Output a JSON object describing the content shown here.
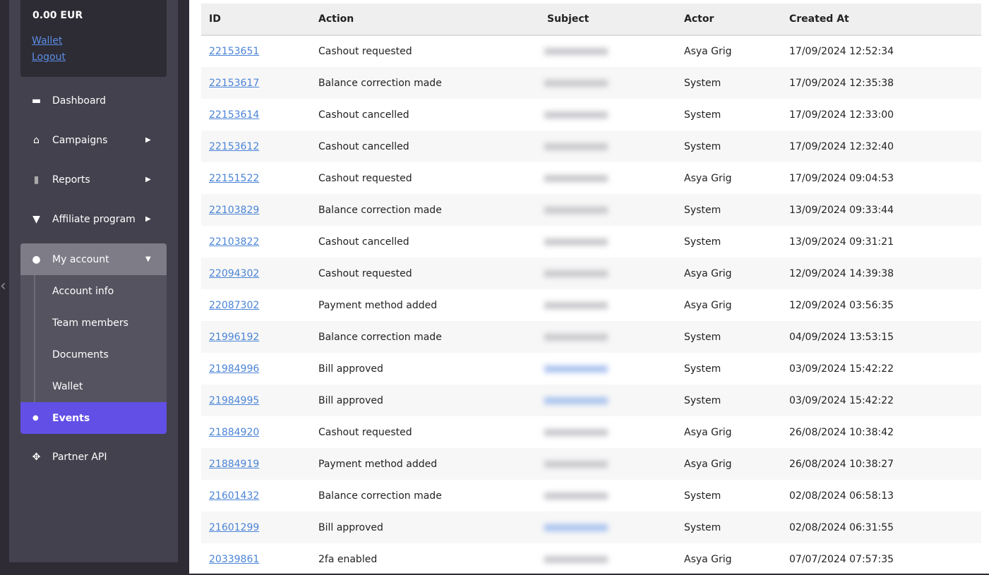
{
  "account": {
    "balance": "0.00  EUR",
    "wallet_link": "Wallet",
    "logout_link": "Logout"
  },
  "nav": {
    "dashboard": "Dashboard",
    "campaigns": "Campaigns",
    "reports": "Reports",
    "affiliate": "Affiliate program",
    "my_account": "My account",
    "account_info": "Account info",
    "team_members": "Team members",
    "documents": "Documents",
    "wallet": "Wallet",
    "events": "Events",
    "partner_api": "Partner API"
  },
  "colors": {
    "accent": "#624fe6",
    "link": "#4a84d6"
  },
  "table": {
    "headers": [
      "ID",
      "Action",
      "Subject",
      "Actor",
      "Created At"
    ],
    "rows": [
      [
        "22153651",
        "Cashout requested",
        "Asya Grig",
        "17/09/2024 12:52:34"
      ],
      [
        "22153617",
        "Balance correction made",
        "System",
        "17/09/2024 12:35:38"
      ],
      [
        "22153614",
        "Cashout cancelled",
        "System",
        "17/09/2024 12:33:00"
      ],
      [
        "22153612",
        "Cashout cancelled",
        "System",
        "17/09/2024 12:32:40"
      ],
      [
        "22151522",
        "Cashout requested",
        "Asya Grig",
        "17/09/2024 09:04:53"
      ],
      [
        "22103829",
        "Balance correction made",
        "System",
        "13/09/2024 09:33:44"
      ],
      [
        "22103822",
        "Cashout cancelled",
        "System",
        "13/09/2024 09:31:21"
      ],
      [
        "22094302",
        "Cashout requested",
        "Asya Grig",
        "12/09/2024 14:39:38"
      ],
      [
        "22087302",
        "Payment method added",
        "Asya Grig",
        "12/09/2024 03:56:35"
      ],
      [
        "21996192",
        "Balance correction made",
        "System",
        "04/09/2024 13:53:15"
      ],
      [
        "21984996",
        "Bill approved",
        "System",
        "03/09/2024 15:42:22"
      ],
      [
        "21984995",
        "Bill approved",
        "System",
        "03/09/2024 15:42:22"
      ],
      [
        "21884920",
        "Cashout requested",
        "Asya Grig",
        "26/08/2024 10:38:42"
      ],
      [
        "21884919",
        "Payment method added",
        "Asya Grig",
        "26/08/2024 10:38:27"
      ],
      [
        "21601432",
        "Balance correction made",
        "System",
        "02/08/2024 06:58:13"
      ],
      [
        "21601299",
        "Bill approved",
        "System",
        "02/08/2024 06:31:55"
      ],
      [
        "20339861",
        "2fa enabled",
        "Asya Grig",
        "07/07/2024 07:57:35"
      ]
    ]
  }
}
